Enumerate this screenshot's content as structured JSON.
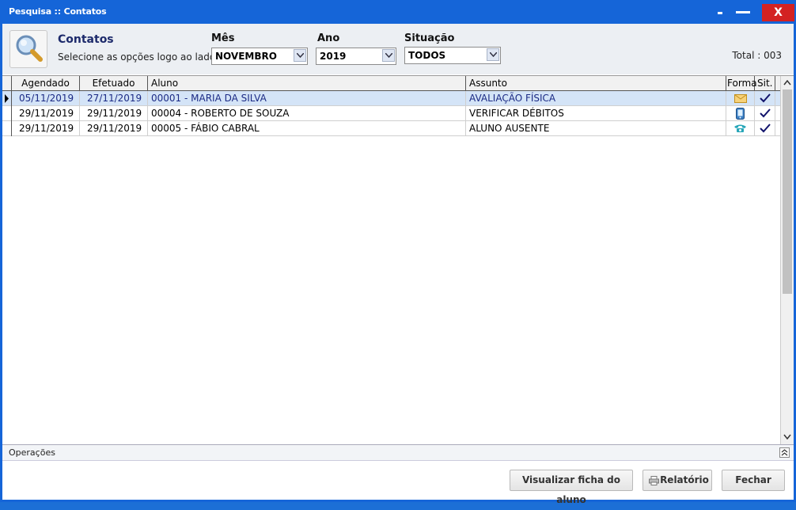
{
  "window": {
    "title": "Pesquisa :: Contatos",
    "close_label": "X"
  },
  "header": {
    "title": "Contatos",
    "subtitle": "Selecione as opções logo ao lado",
    "mes_label": "Mês",
    "mes_value": "NOVEMBRO",
    "ano_label": "Ano",
    "ano_value": "2019",
    "situacao_label": "Situação",
    "situacao_value": "TODOS",
    "total": "Total : 003"
  },
  "grid": {
    "columns": [
      "Agendado",
      "Efetuado",
      "Aluno",
      "Assunto",
      "Forma",
      "Sit."
    ],
    "rows": [
      {
        "agendado": "05/11/2019",
        "efetuado": "27/11/2019",
        "aluno": "00001 - MARIA DA SILVA",
        "assunto": "AVALIAÇÃO FÍSICA",
        "forma": "email-icon",
        "sit": "check-icon"
      },
      {
        "agendado": "29/11/2019",
        "efetuado": "29/11/2019",
        "aluno": "00004 - ROBERTO DE SOUZA",
        "assunto": "VERIFICAR DÉBITOS",
        "forma": "mobile-phone-icon",
        "sit": "check-icon"
      },
      {
        "agendado": "29/11/2019",
        "efetuado": "29/11/2019",
        "aluno": "00005 - FÁBIO CABRAL",
        "assunto": "ALUNO AUSENTE",
        "forma": "telephone-icon",
        "sit": "check-icon"
      }
    ]
  },
  "operations": {
    "label": "Operações"
  },
  "buttons": {
    "view": "Visualizar ficha do aluno",
    "report": "Relatório",
    "close": "Fechar"
  },
  "colors": {
    "titlebar": "#1565d8",
    "close": "#d32222",
    "selected_row": "#d4e4f7",
    "selected_text": "#1b2a85"
  }
}
